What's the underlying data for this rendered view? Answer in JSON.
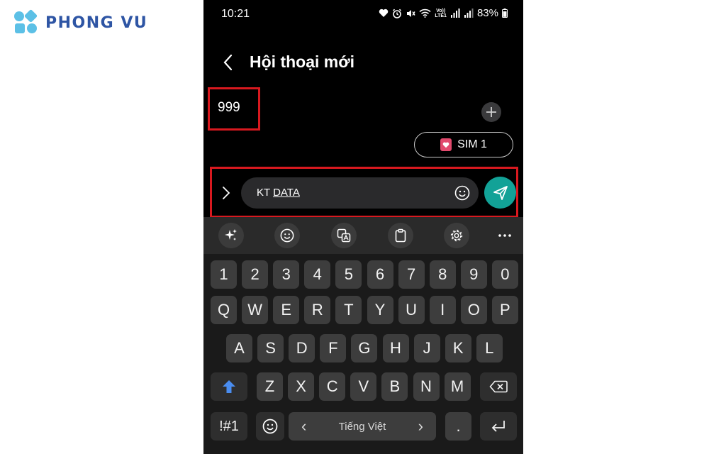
{
  "brand": {
    "name": "PHONG VU",
    "color": "#2e55a4",
    "accent": "#5cc0e6"
  },
  "status_bar": {
    "time": "10:21",
    "volte": "Vo))",
    "lte": "LTE1",
    "battery": "83%"
  },
  "header": {
    "title": "Hội thoại mới",
    "back_icon": "chevron-left-icon"
  },
  "recipient": {
    "value": "999"
  },
  "sim": {
    "label": "SIM 1",
    "color": "#e24a6d"
  },
  "message": {
    "prefix": "KT ",
    "underlined": "DATA"
  },
  "send": {
    "color": "#12a297"
  },
  "keyboard": {
    "toolbar": [
      "sparkle-icon",
      "emoji-icon",
      "translate-icon",
      "clipboard-icon",
      "settings-icon",
      "more-icon"
    ],
    "row_numbers": [
      "1",
      "2",
      "3",
      "4",
      "5",
      "6",
      "7",
      "8",
      "9",
      "0"
    ],
    "row1": [
      "Q",
      "W",
      "E",
      "R",
      "T",
      "Y",
      "U",
      "I",
      "O",
      "P"
    ],
    "row2": [
      "A",
      "S",
      "D",
      "F",
      "G",
      "H",
      "J",
      "K",
      "L"
    ],
    "row3": [
      "Z",
      "X",
      "C",
      "V",
      "B",
      "N",
      "M"
    ],
    "symbols_label": "!#1",
    "space_label": "Tiếng Việt",
    "space_left": "‹",
    "space_right": "›",
    "period": "."
  },
  "annotation_color": "#d8191f"
}
